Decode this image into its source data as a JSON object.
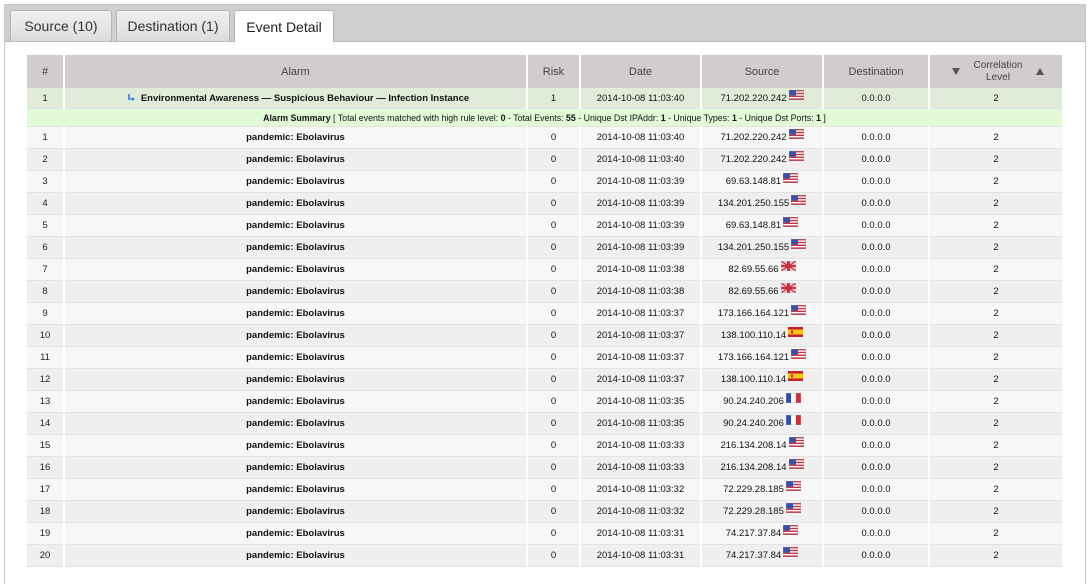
{
  "tabs": [
    {
      "label": "Source (10)",
      "active": false
    },
    {
      "label": "Destination (1)",
      "active": false
    },
    {
      "label": "Event Detail",
      "active": true
    }
  ],
  "columns": {
    "num": "#",
    "alarm": "Alarm",
    "risk": "Risk",
    "date": "Date",
    "source": "Source",
    "destination": "Destination",
    "correlation_line1": "Correlation",
    "correlation_line2": "Level"
  },
  "main_alarm": {
    "num": "1",
    "name": "Environmental Awareness — Suspicious Behaviour — Infection Instance",
    "risk": "1",
    "date": "2014-10-08 11:03:40",
    "source": "71.202.220.242",
    "source_flag": "us",
    "destination": "0.0.0.0",
    "level": "2"
  },
  "summary": {
    "title": "Alarm Summary",
    "open": " [ Total events matched with high rule level: ",
    "high_level": "0",
    "sep1": " - Total Events: ",
    "total_events": "55",
    "sep2": " - Unique Dst IPAddr: ",
    "unique_dst": "1",
    "sep3": " - Unique Types: ",
    "unique_types": "1",
    "sep4": " - Unique Dst Ports: ",
    "unique_ports": "1",
    "close": " ]"
  },
  "events": [
    {
      "num": "1",
      "alarm": "pandemic: Ebolavirus",
      "risk": "0",
      "date": "2014-10-08 11:03:40",
      "source": "71.202.220.242",
      "flag": "us",
      "destination": "0.0.0.0",
      "level": "2"
    },
    {
      "num": "2",
      "alarm": "pandemic: Ebolavirus",
      "risk": "0",
      "date": "2014-10-08 11:03:40",
      "source": "71.202.220.242",
      "flag": "us",
      "destination": "0.0.0.0",
      "level": "2"
    },
    {
      "num": "3",
      "alarm": "pandemic: Ebolavirus",
      "risk": "0",
      "date": "2014-10-08 11:03:39",
      "source": "69.63.148.81",
      "flag": "us",
      "destination": "0.0.0.0",
      "level": "2"
    },
    {
      "num": "4",
      "alarm": "pandemic: Ebolavirus",
      "risk": "0",
      "date": "2014-10-08 11:03:39",
      "source": "134.201.250.155",
      "flag": "us",
      "destination": "0.0.0.0",
      "level": "2"
    },
    {
      "num": "5",
      "alarm": "pandemic: Ebolavirus",
      "risk": "0",
      "date": "2014-10-08 11:03:39",
      "source": "69.63.148.81",
      "flag": "us",
      "destination": "0.0.0.0",
      "level": "2"
    },
    {
      "num": "6",
      "alarm": "pandemic: Ebolavirus",
      "risk": "0",
      "date": "2014-10-08 11:03:39",
      "source": "134.201.250.155",
      "flag": "us",
      "destination": "0.0.0.0",
      "level": "2"
    },
    {
      "num": "7",
      "alarm": "pandemic: Ebolavirus",
      "risk": "0",
      "date": "2014-10-08 11:03:38",
      "source": "82.69.55.66",
      "flag": "gb",
      "destination": "0.0.0.0",
      "level": "2"
    },
    {
      "num": "8",
      "alarm": "pandemic: Ebolavirus",
      "risk": "0",
      "date": "2014-10-08 11:03:38",
      "source": "82.69.55.66",
      "flag": "gb",
      "destination": "0.0.0.0",
      "level": "2"
    },
    {
      "num": "9",
      "alarm": "pandemic: Ebolavirus",
      "risk": "0",
      "date": "2014-10-08 11:03:37",
      "source": "173.166.164.121",
      "flag": "us",
      "destination": "0.0.0.0",
      "level": "2"
    },
    {
      "num": "10",
      "alarm": "pandemic: Ebolavirus",
      "risk": "0",
      "date": "2014-10-08 11:03:37",
      "source": "138.100.110.14",
      "flag": "es",
      "destination": "0.0.0.0",
      "level": "2"
    },
    {
      "num": "11",
      "alarm": "pandemic: Ebolavirus",
      "risk": "0",
      "date": "2014-10-08 11:03:37",
      "source": "173.166.164.121",
      "flag": "us",
      "destination": "0.0.0.0",
      "level": "2"
    },
    {
      "num": "12",
      "alarm": "pandemic: Ebolavirus",
      "risk": "0",
      "date": "2014-10-08 11:03:37",
      "source": "138.100.110.14",
      "flag": "es",
      "destination": "0.0.0.0",
      "level": "2"
    },
    {
      "num": "13",
      "alarm": "pandemic: Ebolavirus",
      "risk": "0",
      "date": "2014-10-08 11:03:35",
      "source": "90.24.240.206",
      "flag": "fr",
      "destination": "0.0.0.0",
      "level": "2"
    },
    {
      "num": "14",
      "alarm": "pandemic: Ebolavirus",
      "risk": "0",
      "date": "2014-10-08 11:03:35",
      "source": "90.24.240.206",
      "flag": "fr",
      "destination": "0.0.0.0",
      "level": "2"
    },
    {
      "num": "15",
      "alarm": "pandemic: Ebolavirus",
      "risk": "0",
      "date": "2014-10-08 11:03:33",
      "source": "216.134.208.14",
      "flag": "us",
      "destination": "0.0.0.0",
      "level": "2"
    },
    {
      "num": "16",
      "alarm": "pandemic: Ebolavirus",
      "risk": "0",
      "date": "2014-10-08 11:03:33",
      "source": "216.134.208.14",
      "flag": "us",
      "destination": "0.0.0.0",
      "level": "2"
    },
    {
      "num": "17",
      "alarm": "pandemic: Ebolavirus",
      "risk": "0",
      "date": "2014-10-08 11:03:32",
      "source": "72.229.28.185",
      "flag": "us",
      "destination": "0.0.0.0",
      "level": "2"
    },
    {
      "num": "18",
      "alarm": "pandemic: Ebolavirus",
      "risk": "0",
      "date": "2014-10-08 11:03:32",
      "source": "72.229.28.185",
      "flag": "us",
      "destination": "0.0.0.0",
      "level": "2"
    },
    {
      "num": "19",
      "alarm": "pandemic: Ebolavirus",
      "risk": "0",
      "date": "2014-10-08 11:03:31",
      "source": "74.217.37.84",
      "flag": "us",
      "destination": "0.0.0.0",
      "level": "2"
    },
    {
      "num": "20",
      "alarm": "pandemic: Ebolavirus",
      "risk": "0",
      "date": "2014-10-08 11:03:31",
      "source": "74.217.37.84",
      "flag": "us",
      "destination": "0.0.0.0",
      "level": "2"
    }
  ],
  "flag_icons": {
    "us": "us-flag-icon",
    "gb": "gb-flag-icon",
    "es": "es-flag-icon",
    "fr": "fr-flag-icon"
  },
  "colors": {
    "header_bg": "#d1cdcd",
    "main_row_bg": "#e0ecd9",
    "summary_bg": "#e2fbd6",
    "tabbar_bg": "#cfcfcf"
  }
}
